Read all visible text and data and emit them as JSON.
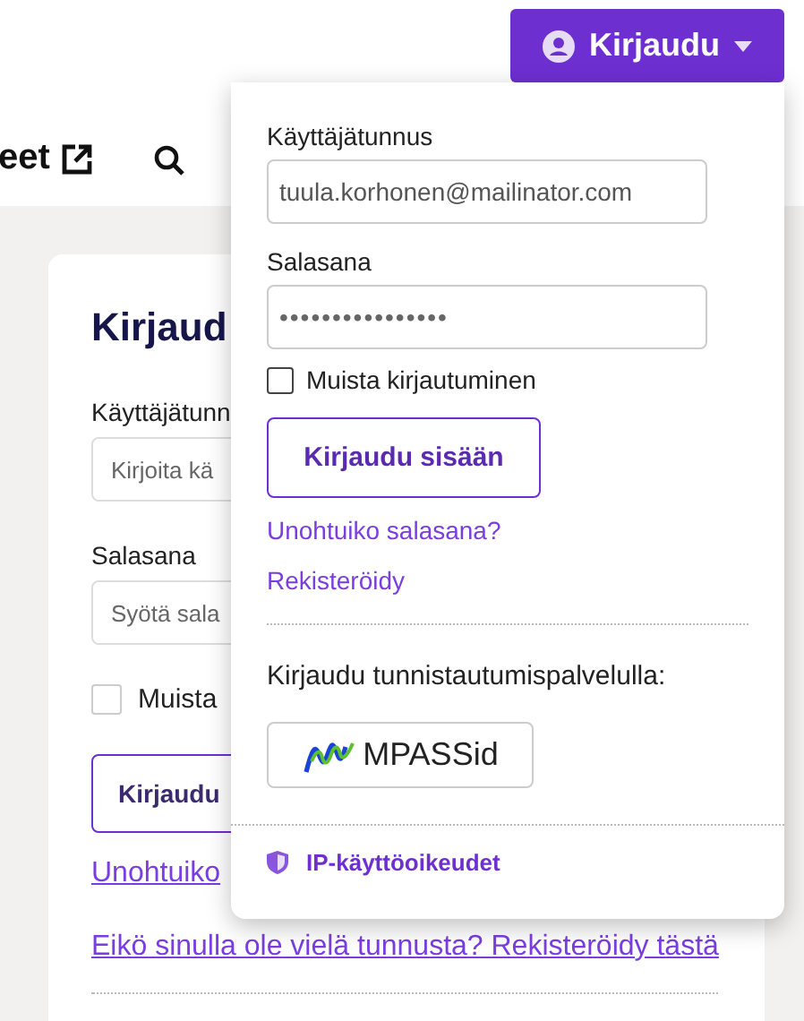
{
  "header": {
    "nav_link": "eet",
    "login_button": "Kirjaudu"
  },
  "page_card": {
    "title": "Kirjaud",
    "username_label": "Käyttäjätunn",
    "username_placeholder": "Kirjoita kä",
    "password_label": "Salasana",
    "password_placeholder": "Syötä sala",
    "remember": {
      "label": "Muista",
      "checked": false
    },
    "submit": "Kirjaudu",
    "forgot_link": "Unohtuiko",
    "register_link": "Eikö sinulla ole vielä tunnusta? Rekisteröidy tästä"
  },
  "dropdown": {
    "username_label": "Käyttäjätunnus",
    "username_value": "tuula.korhonen@mailinator.com",
    "password_label": "Salasana",
    "password_value": "••••••••••••••••",
    "remember": {
      "label": "Muista kirjautuminen",
      "checked": false
    },
    "submit": "Kirjaudu sisään",
    "forgot_link": "Unohtuiko salasana?",
    "register_link": "Rekisteröidy",
    "sso_heading": "Kirjaudu tunnistautumispalvelulla:",
    "sso_button": "MPASSid",
    "ip_link": "IP-käyttöoikeudet"
  }
}
